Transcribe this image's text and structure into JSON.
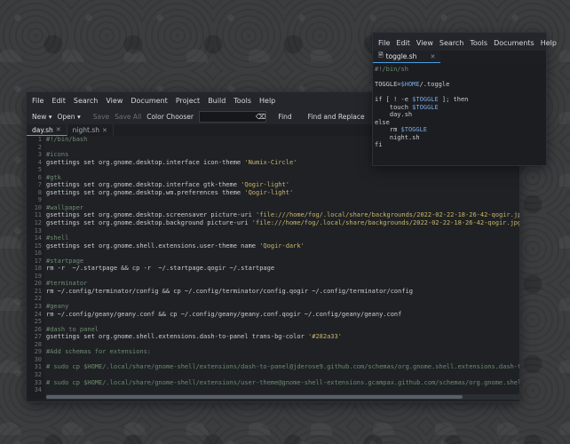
{
  "main_window": {
    "menu": [
      "File",
      "Edit",
      "Search",
      "View",
      "Document",
      "Project",
      "Build",
      "Tools",
      "Help"
    ],
    "toolbar": {
      "new": "New",
      "open": "Open",
      "save": "Save",
      "save_all": "Save All",
      "color_chooser": "Color Chooser",
      "find": "Find",
      "find_replace": "Find and Replace"
    },
    "tabs": [
      {
        "label": "day.sh",
        "active": true
      },
      {
        "label": "night.sh",
        "active": false
      }
    ],
    "lines": [
      "#!/bin/bash",
      "",
      "#icons",
      "gsettings set org.gnome.desktop.interface icon-theme 'Numix-Circle'",
      "",
      "#gtk",
      "gsettings set org.gnome.desktop.interface gtk-theme 'Qogir-light'",
      "gsettings set org.gnome.desktop.wm.preferences theme 'Qogir-light'",
      "",
      "#wallpaper",
      "gsettings set org.gnome.desktop.screensaver picture-uri 'file:///home/fog/.local/share/backgrounds/2022-02-22-18-26-42-qogir.jpg'",
      "gsettings set org.gnome.desktop.background picture-uri 'file:///home/fog/.local/share/backgrounds/2022-02-22-18-26-42-qogir.jpg'",
      "",
      "#shell",
      "gsettings set org.gnome.shell.extensions.user-theme name 'Qogir-dark'",
      "",
      "#startpage",
      "rm -r  ~/.startpage && cp -r  ~/.startpage.qogir ~/.startpage",
      "",
      "#terminator",
      "rm ~/.config/terminator/config && cp ~/.config/terminator/config.qogir ~/.config/terminator/config",
      "",
      "#geany",
      "rm ~/.config/geany/geany.conf && cp ~/.config/geany/geany.conf.qogir ~/.config/geany/geany.conf",
      "",
      "#dash to panel",
      "gsettings set org.gnome.shell.extensions.dash-to-panel trans-bg-color '#282a33'",
      "",
      "#Add schemas for extensions:",
      "",
      "# sudo cp $HOME/.local/share/gnome-shell/extensions/dash-to-panel@jderose9.github.com/schemas/org.gnome.shell.extensions.dash-to-panel.",
      "",
      "# sudo cp $HOME/.local/share/gnome-shell/extensions/user-theme@gnome-shell-extensions.gcampax.github.com/schemas/org.gnome.shell.extens",
      ""
    ]
  },
  "second_window": {
    "menu": [
      "File",
      "Edit",
      "View",
      "Search",
      "Tools",
      "Documents",
      "Help"
    ],
    "tab": "toggle.sh",
    "lines": [
      "#!/bin/sh",
      "",
      "TOGGLE=$HOME/.toggle",
      "",
      "if [ ! -e $TOGGLE ]; then",
      "    touch $TOGGLE",
      "    day.sh",
      "else",
      "    rm $TOGGLE",
      "    night.sh",
      "fi"
    ]
  },
  "colors": {
    "accent": "#4aa0e0",
    "comment": "#6f8a6f",
    "string": "#c9b76a",
    "variable": "#79a8e6"
  }
}
